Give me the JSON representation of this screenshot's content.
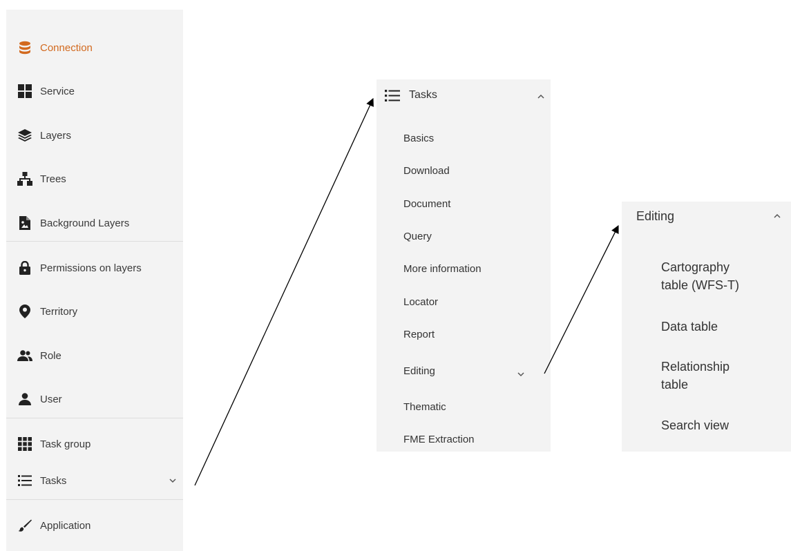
{
  "sidebar": {
    "items": [
      {
        "label": "Connection",
        "icon": "database-icon",
        "active": true
      },
      {
        "label": "Service",
        "icon": "grid-icon"
      },
      {
        "label": "Layers",
        "icon": "layers-icon"
      },
      {
        "label": "Trees",
        "icon": "sitemap-icon"
      },
      {
        "label": "Background Layers",
        "icon": "image-file-icon"
      },
      {
        "label": "Permissions on layers",
        "icon": "lock-icon"
      },
      {
        "label": "Territory",
        "icon": "map-marker-icon"
      },
      {
        "label": "Role",
        "icon": "users-icon"
      },
      {
        "label": "User",
        "icon": "user-icon"
      },
      {
        "label": "Task group",
        "icon": "grid-3x3-icon"
      },
      {
        "label": "Tasks",
        "icon": "list-icon"
      },
      {
        "label": "Application",
        "icon": "brush-icon"
      }
    ]
  },
  "tasks_panel": {
    "title": "Tasks",
    "items": [
      "Basics",
      "Download",
      "Document",
      "Query",
      "More information",
      "Locator",
      "Report",
      "Editing",
      "Thematic",
      "FME Extraction"
    ]
  },
  "editing_panel": {
    "title": "Editing",
    "items": [
      "Cartography table (WFS-T)",
      "Data table",
      "Relationship table",
      "Search view"
    ]
  },
  "colors": {
    "active": "#d2691e",
    "panel_bg": "#f3f3f3",
    "text": "#333333",
    "icon": "#222222"
  }
}
